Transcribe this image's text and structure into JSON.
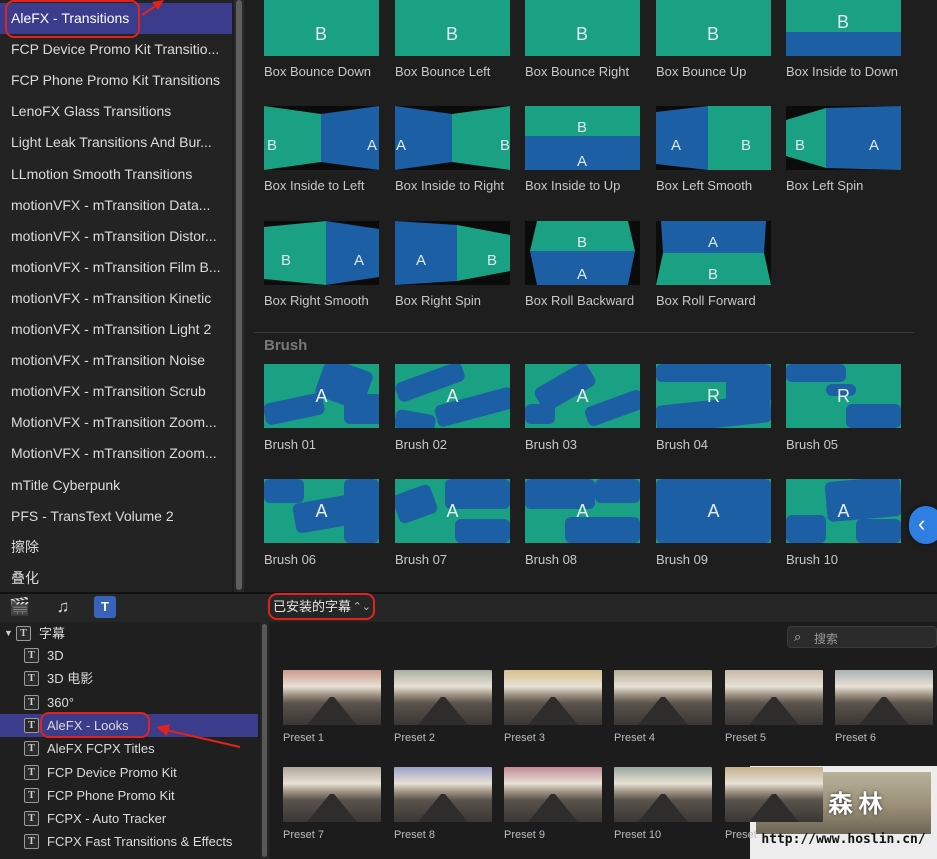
{
  "top_sidebar": {
    "items": [
      {
        "label": "AleFX - Transitions",
        "selected": true
      },
      {
        "label": "FCP Device Promo Kit Transitio..."
      },
      {
        "label": "FCP Phone Promo Kit Transitions"
      },
      {
        "label": "LenoFX Glass Transitions"
      },
      {
        "label": "Light Leak Transitions And Bur..."
      },
      {
        "label": "LLmotion Smooth Transitions"
      },
      {
        "label": "motionVFX - mTransition Data..."
      },
      {
        "label": "motionVFX - mTransition Distor..."
      },
      {
        "label": "motionVFX - mTransition Film B..."
      },
      {
        "label": "motionVFX - mTransition Kinetic"
      },
      {
        "label": "motionVFX - mTransition Light 2"
      },
      {
        "label": "motionVFX - mTransition Noise"
      },
      {
        "label": "motionVFX - mTransition Scrub"
      },
      {
        "label": "MotionVFX - mTransition Zoom..."
      },
      {
        "label": "MotionVFX - mTransition Zoom..."
      },
      {
        "label": "mTitle Cyberpunk"
      },
      {
        "label": "PFS - TransText Volume 2"
      },
      {
        "label": "擦除"
      },
      {
        "label": "叠化"
      }
    ]
  },
  "box_tiles": [
    {
      "label": "Box Bounce Down",
      "glyphs": [
        "B"
      ]
    },
    {
      "label": "Box Bounce Left",
      "glyphs": [
        "B"
      ]
    },
    {
      "label": "Box Bounce Right",
      "glyphs": [
        "B"
      ]
    },
    {
      "label": "Box Bounce Up",
      "glyphs": [
        "B"
      ]
    },
    {
      "label": "Box Inside to Down",
      "glyphs": [
        "B"
      ]
    },
    {
      "label": "Box Inside to Left",
      "glyphs": [
        "B",
        "A"
      ]
    },
    {
      "label": "Box Inside to Right",
      "glyphs": [
        "A",
        "B"
      ]
    },
    {
      "label": "Box Inside to Up",
      "glyphs": [
        "B",
        "A"
      ]
    },
    {
      "label": "Box Left Smooth",
      "glyphs": [
        "A",
        "B"
      ]
    },
    {
      "label": "Box Left Spin",
      "glyphs": [
        "B",
        "A"
      ]
    },
    {
      "label": "Box Right Smooth",
      "glyphs": [
        "B",
        "A"
      ]
    },
    {
      "label": "Box Right Spin",
      "glyphs": [
        "A",
        "B"
      ]
    },
    {
      "label": "Box Roll Backward",
      "glyphs": [
        "B",
        "A"
      ]
    },
    {
      "label": "Box Roll Forward",
      "glyphs": [
        "A",
        "B"
      ]
    }
  ],
  "brush_section": {
    "heading": "Brush",
    "tiles": [
      {
        "label": "Brush 01",
        "glyph": "A"
      },
      {
        "label": "Brush 02",
        "glyph": "A"
      },
      {
        "label": "Brush 03",
        "glyph": "A"
      },
      {
        "label": "Brush 04",
        "glyph": "R"
      },
      {
        "label": "Brush 05",
        "glyph": "R"
      },
      {
        "label": "Brush 06",
        "glyph": "A"
      },
      {
        "label": "Brush 07",
        "glyph": "A"
      },
      {
        "label": "Brush 08",
        "glyph": "A"
      },
      {
        "label": "Brush 09",
        "glyph": "A"
      },
      {
        "label": "Brush 10",
        "glyph": "A"
      }
    ]
  },
  "toolbar": {
    "icons": [
      "clapper-icon",
      "music-icon",
      "titles-icon"
    ],
    "library_dropdown": "已安装的字幕",
    "search_placeholder": "搜索"
  },
  "bottom_sidebar": {
    "root_label": "字幕",
    "items": [
      {
        "label": "3D"
      },
      {
        "label": "3D 电影"
      },
      {
        "label": "360°"
      },
      {
        "label": "AleFX - Looks",
        "selected": true
      },
      {
        "label": "AleFX FCPX Titles"
      },
      {
        "label": "FCP Device Promo Kit"
      },
      {
        "label": "FCP Phone Promo Kit"
      },
      {
        "label": "FCPX - Auto Tracker"
      },
      {
        "label": "FCPX Fast Transitions & Effects"
      }
    ]
  },
  "presets": [
    {
      "label": "Preset 1",
      "tint": "#c99a8a"
    },
    {
      "label": "Preset 2",
      "tint": "#a8b0a0"
    },
    {
      "label": "Preset 3",
      "tint": "#d8c08c"
    },
    {
      "label": "Preset 4",
      "tint": "#b7ab96"
    },
    {
      "label": "Preset 5",
      "tint": "#c8b8a8"
    },
    {
      "label": "Preset 6",
      "tint": "#a9b2b4"
    },
    {
      "label": "Preset 7",
      "tint": "#b0a69a"
    },
    {
      "label": "Preset 8",
      "tint": "#9aa0c8"
    },
    {
      "label": "Preset 9",
      "tint": "#c08a94"
    },
    {
      "label": "Preset 10",
      "tint": "#98a89e"
    },
    {
      "label": "Preset",
      "tint": "#c4b08c"
    }
  ],
  "watermark": {
    "title": "红森林",
    "url": "http://www.hoslin.cn/"
  },
  "colors": {
    "teal": "#1aa083",
    "blue": "#1d5fa4",
    "selection": "#3b3c8c",
    "annotation": "#e0241d",
    "accent": "#2f7fe3"
  }
}
